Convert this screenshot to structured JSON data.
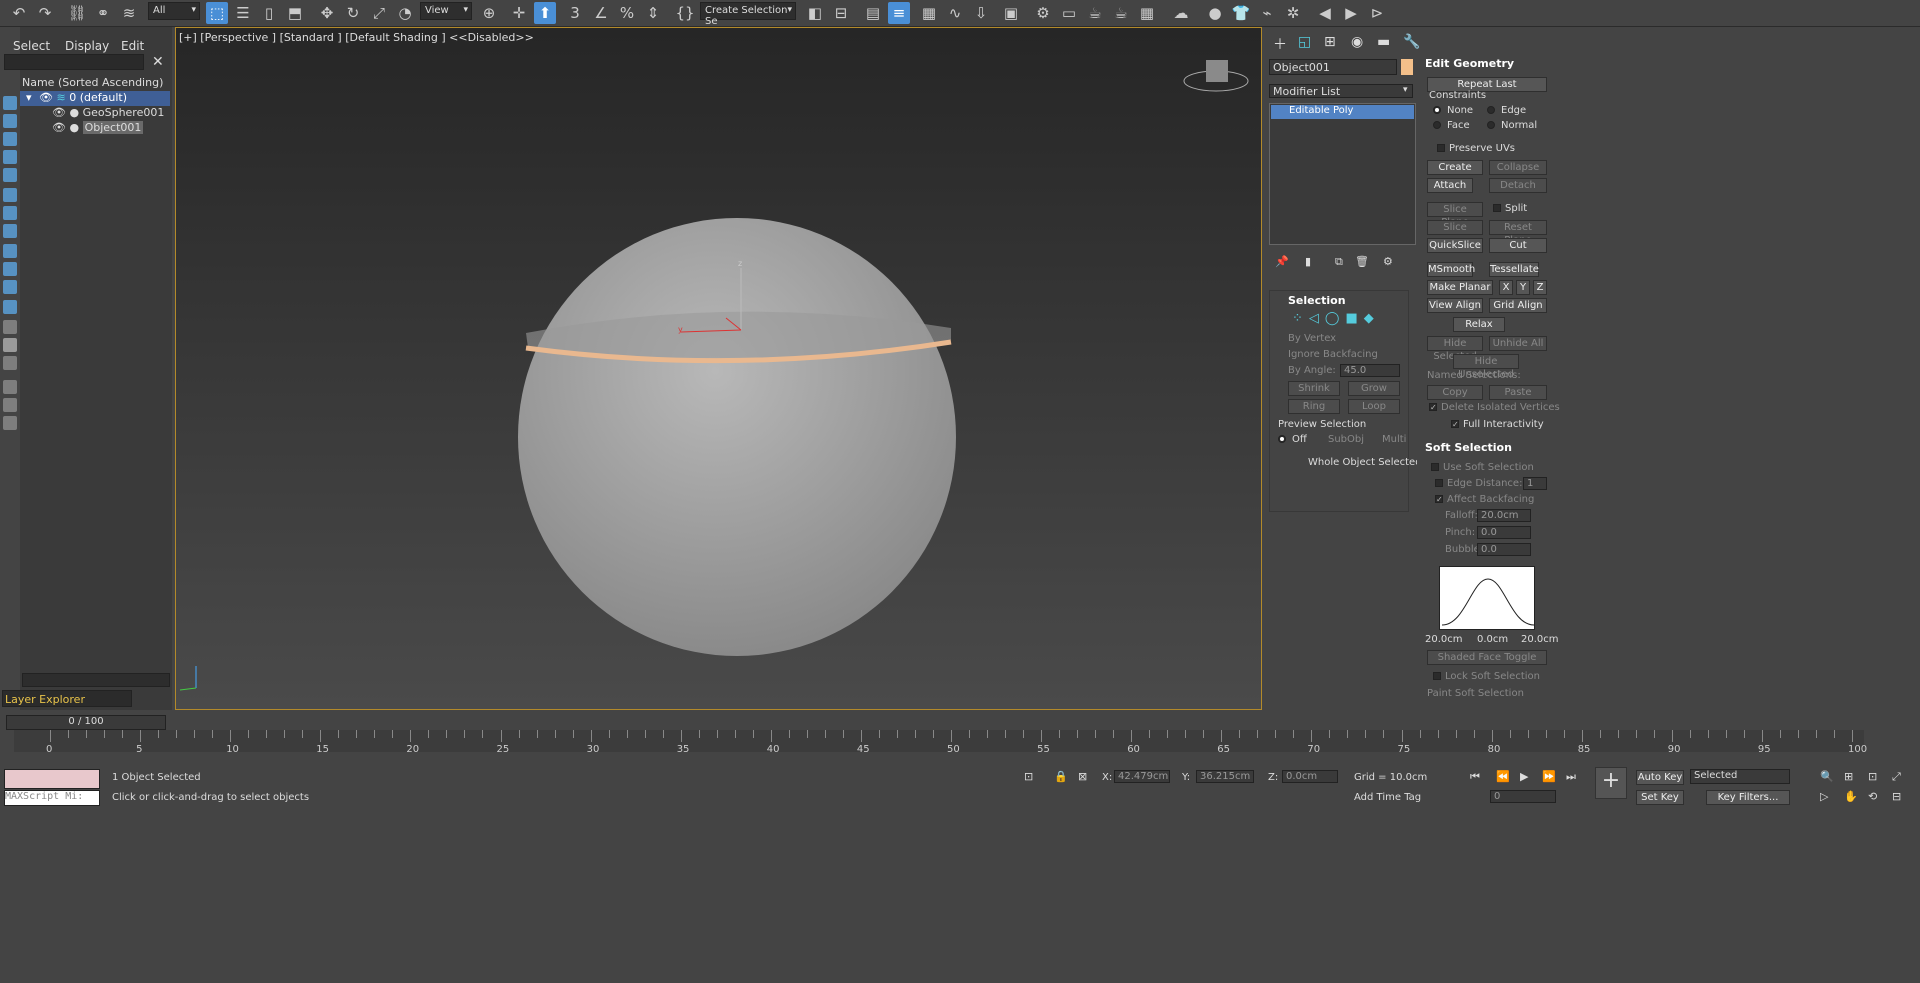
{
  "toolbar": {
    "filter": "All",
    "view": "View",
    "selection_set": "Create Selection Se"
  },
  "scene_explorer": {
    "menu": [
      "Select",
      "Display",
      "Edit"
    ],
    "header": "Name (Sorted Ascending)",
    "items": [
      "0 (default)",
      "GeoSphere001",
      "Object001"
    ],
    "layer_explorer": "Layer Explorer",
    "frame": "0 / 100"
  },
  "viewport": {
    "label": "[+] [Perspective ] [Standard ] [Default Shading ]  <<Disabled>>"
  },
  "command_panel": {
    "object_name": "Object001",
    "object_color": "#f4c08a",
    "modifier_list": "Modifier List",
    "stack": [
      "Editable Poly"
    ],
    "selection": {
      "title": "Selection",
      "by_vertex": "By Vertex",
      "ignore_backfacing": "Ignore Backfacing",
      "by_angle": "By Angle:",
      "angle": "45.0",
      "shrink": "Shrink",
      "grow": "Grow",
      "ring": "Ring",
      "loop": "Loop",
      "preview": "Preview Selection",
      "off": "Off",
      "subobj": "SubObj",
      "multi": "Multi",
      "status": "Whole Object Selected"
    }
  },
  "edit_geometry": {
    "title": "Edit Geometry",
    "repeat_last": "Repeat Last",
    "constraints": "Constraints",
    "none": "None",
    "edge": "Edge",
    "face": "Face",
    "normal": "Normal",
    "preserve_uvs": "Preserve UVs",
    "create": "Create",
    "collapse": "Collapse",
    "attach": "Attach",
    "detach": "Detach",
    "slice_plane": "Slice Plane",
    "split": "Split",
    "slice": "Slice",
    "reset_plane": "Reset Plane",
    "quickslice": "QuickSlice",
    "cut": "Cut",
    "msmooth": "MSmooth",
    "tessellate": "Tessellate",
    "make_planar": "Make Planar",
    "x": "X",
    "y": "Y",
    "z": "Z",
    "view_align": "View Align",
    "grid_align": "Grid Align",
    "relax": "Relax",
    "hide_selected": "Hide Selected",
    "unhide_all": "Unhide All",
    "hide_unselected": "Hide Unselected",
    "named_selections": "Named Selections:",
    "copy": "Copy",
    "paste": "Paste",
    "delete_isolated": "Delete Isolated Vertices",
    "full_interactivity": "Full Interactivity"
  },
  "soft_selection": {
    "title": "Soft Selection",
    "use": "Use Soft Selection",
    "edge_distance": "Edge Distance:",
    "edge_distance_val": "1",
    "affect_backfacing": "Affect Backfacing",
    "falloff": "Falloff:",
    "falloff_val": "20.0cm",
    "pinch": "Pinch:",
    "pinch_val": "0.0",
    "bubble": "Bubble:",
    "bubble_val": "0.0",
    "curve_left": "20.0cm",
    "curve_mid": "0.0cm",
    "curve_right": "20.0cm",
    "shaded_face_toggle": "Shaded Face Toggle",
    "lock": "Lock Soft Selection",
    "paint": "Paint Soft Selection"
  },
  "status": {
    "selected": "1 Object Selected",
    "hint": "Click or click-and-drag to select objects",
    "maxscript": "MAXScript Mi:",
    "x_label": "X:",
    "x": "42.479cm",
    "y_label": "Y:",
    "y": "36.215cm",
    "z_label": "Z:",
    "z": "0.0cm",
    "grid": "Grid = 10.0cm",
    "add_time_tag": "Add Time Tag",
    "auto_key": "Auto Key",
    "set_key": "Set Key",
    "selected_dd": "Selected",
    "key_filters": "Key Filters...",
    "frame_field": "0"
  },
  "timeline": {
    "ticks": [
      "0",
      "5",
      "10",
      "15",
      "20",
      "25",
      "30",
      "35",
      "40",
      "45",
      "50",
      "55",
      "60",
      "65",
      "70",
      "75",
      "80",
      "85",
      "90",
      "95",
      "100"
    ]
  }
}
